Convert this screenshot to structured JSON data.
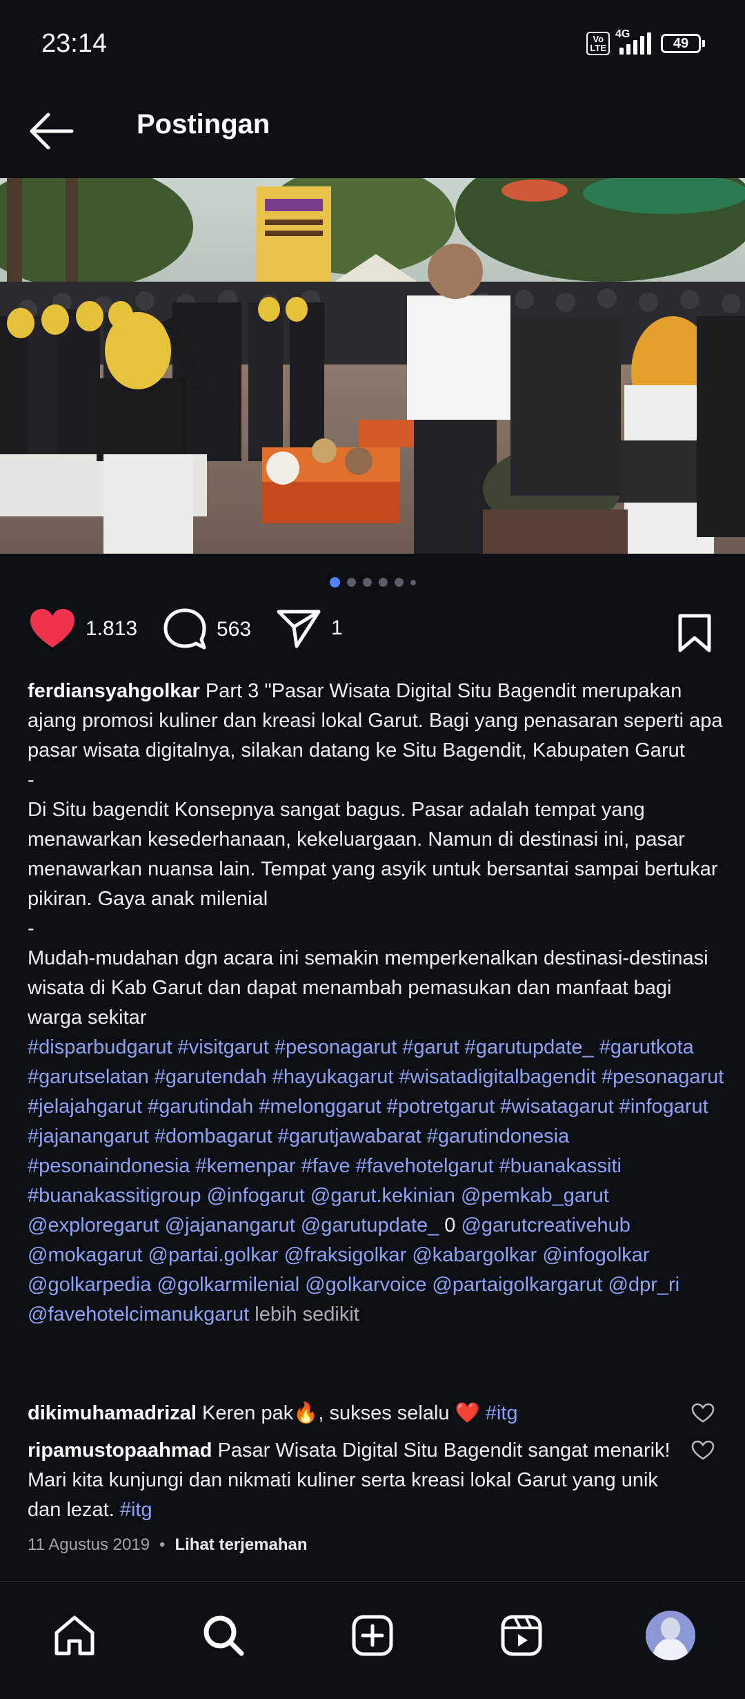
{
  "status_bar": {
    "time": "23:14",
    "volte_label": "Vo\nLTE",
    "network_label": "4G",
    "battery": "49"
  },
  "header": {
    "title": "Postingan"
  },
  "post": {
    "carousel": {
      "count": 6,
      "active_index": 0
    },
    "likes": "1.813",
    "comments": "563",
    "shares": "1",
    "caption": {
      "username": "ferdiansyahgolkar",
      "text": " Part 3 \"Pasar Wisata Digital Situ Bagendit merupakan ajang promosi kuliner dan kreasi lokal Garut. Bagi yang penasaran seperti apa pasar wisata digitalnya, silakan datang ke Situ Bagendit, Kabupaten Garut\n-\nDi Situ bagendit Konsepnya sangat bagus. Pasar adalah tempat yang menawarkan kesederhanaan, kekeluargaan. Namun di destinasi ini, pasar menawarkan nuansa lain. Tempat yang asyik untuk bersantai sampai bertukar pikiran. Gaya anak milenial\n-\nMudah-mudahan dgn acara ini semakin memperkenalkan destinasi-destinasi wisata di Kab Garut dan dapat menambah pemasukan dan manfaat bagi warga sekitar\n",
      "hashtags": "#disparbudgarut #visitgarut #pesonagarut #garut #garutupdate_ #garutkota #garutselatan #garutendah #hayukagarut #wisatadigitalbagendit #pesonagarut #jelajahgarut #garutindah #melonggarut #potretgarut #wisatagarut #infogarut #jajanangarut #dombagarut #garutjawabarat #garutindonesia #pesonaindonesia #kemenpar #fave #favehotelgarut #buanakassiti #buanakassitigroup @infogarut @garut.kekinian @pemkab_garut @exploregarut @jajanangarut @garutupdate_",
      "plain_zero": " 0 ",
      "mentions": "@garutcreativehub @mokagarut @partai.golkar @fraksigolkar @kabargolkar @infogolkar @golkarpedia @golkarmilenial @golkarvoice @partaigolkargarut @dpr_ri @favehotelcimanukgarut",
      "less_label": " lebih sedikit"
    },
    "comments_list": [
      {
        "username": "dikimuhamadrizal",
        "text": " Keren pak🔥, sukses selalu ❤️ ",
        "tag": "#itg"
      },
      {
        "username": "ripamustopaahmad",
        "text": " Pasar Wisata Digital Situ Bagendit sangat menarik! Mari kita kunjungi dan nikmati kuliner serta kreasi lokal Garut yang unik dan lezat. ",
        "tag": "#itg"
      }
    ],
    "date": "11 Agustus 2019",
    "separator": "•",
    "translate_label": "Lihat terjemahan"
  },
  "bottom_nav": {
    "items": [
      "home-icon",
      "search-icon",
      "create-icon",
      "reels-icon",
      "profile-avatar"
    ]
  },
  "colors": {
    "background": "#0c0f14",
    "link": "#8ea2f4",
    "like_red": "#f0334f",
    "dot_active": "#4f83ff"
  }
}
